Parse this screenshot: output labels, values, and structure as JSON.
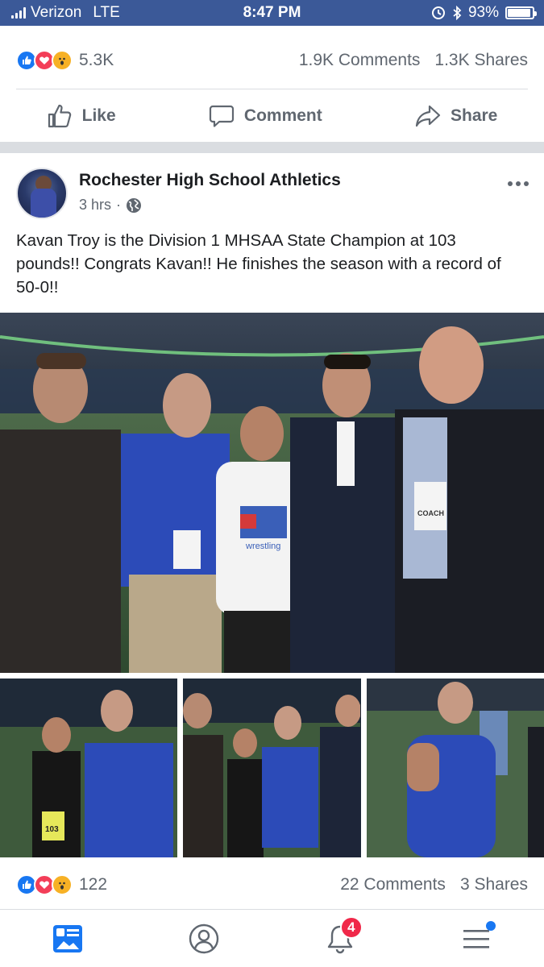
{
  "status_bar": {
    "carrier": "Verizon",
    "network": "LTE",
    "time": "8:47 PM",
    "battery": "93%",
    "battery_level": 0.93
  },
  "previous_post": {
    "reaction_count": "5.3K",
    "comments": "1.9K Comments",
    "shares": "1.3K Shares",
    "actions": {
      "like": "Like",
      "comment": "Comment",
      "share": "Share"
    }
  },
  "post": {
    "author": "Rochester High School Athletics",
    "time": "3 hrs",
    "separator": "·",
    "text": "Kavan Troy is the Division 1 MHSAA State Champion at 103 pounds!! Congrats Kavan!! He finishes the season with a record of 50-0!!",
    "photo_text": {
      "badge_label": "COACH",
      "shirt_text": "wrestling",
      "bib_number": "103"
    },
    "reaction_count": "122",
    "comments": "22 Comments",
    "shares": "3 Shares"
  },
  "tabbar": {
    "notification_badge": "4"
  },
  "colors": {
    "header_blue": "#3b5998",
    "like_blue": "#1877f2",
    "love_red": "#f33e58",
    "wow_yellow": "#f7b125",
    "badge_red": "#f02849"
  },
  "icons": [
    "signal-icon",
    "alarm-icon",
    "bluetooth-icon",
    "battery-icon",
    "like-icon",
    "comment-icon",
    "share-icon",
    "globe-icon",
    "more-icon",
    "news-feed-icon",
    "profile-icon",
    "notifications-icon",
    "menu-icon"
  ]
}
